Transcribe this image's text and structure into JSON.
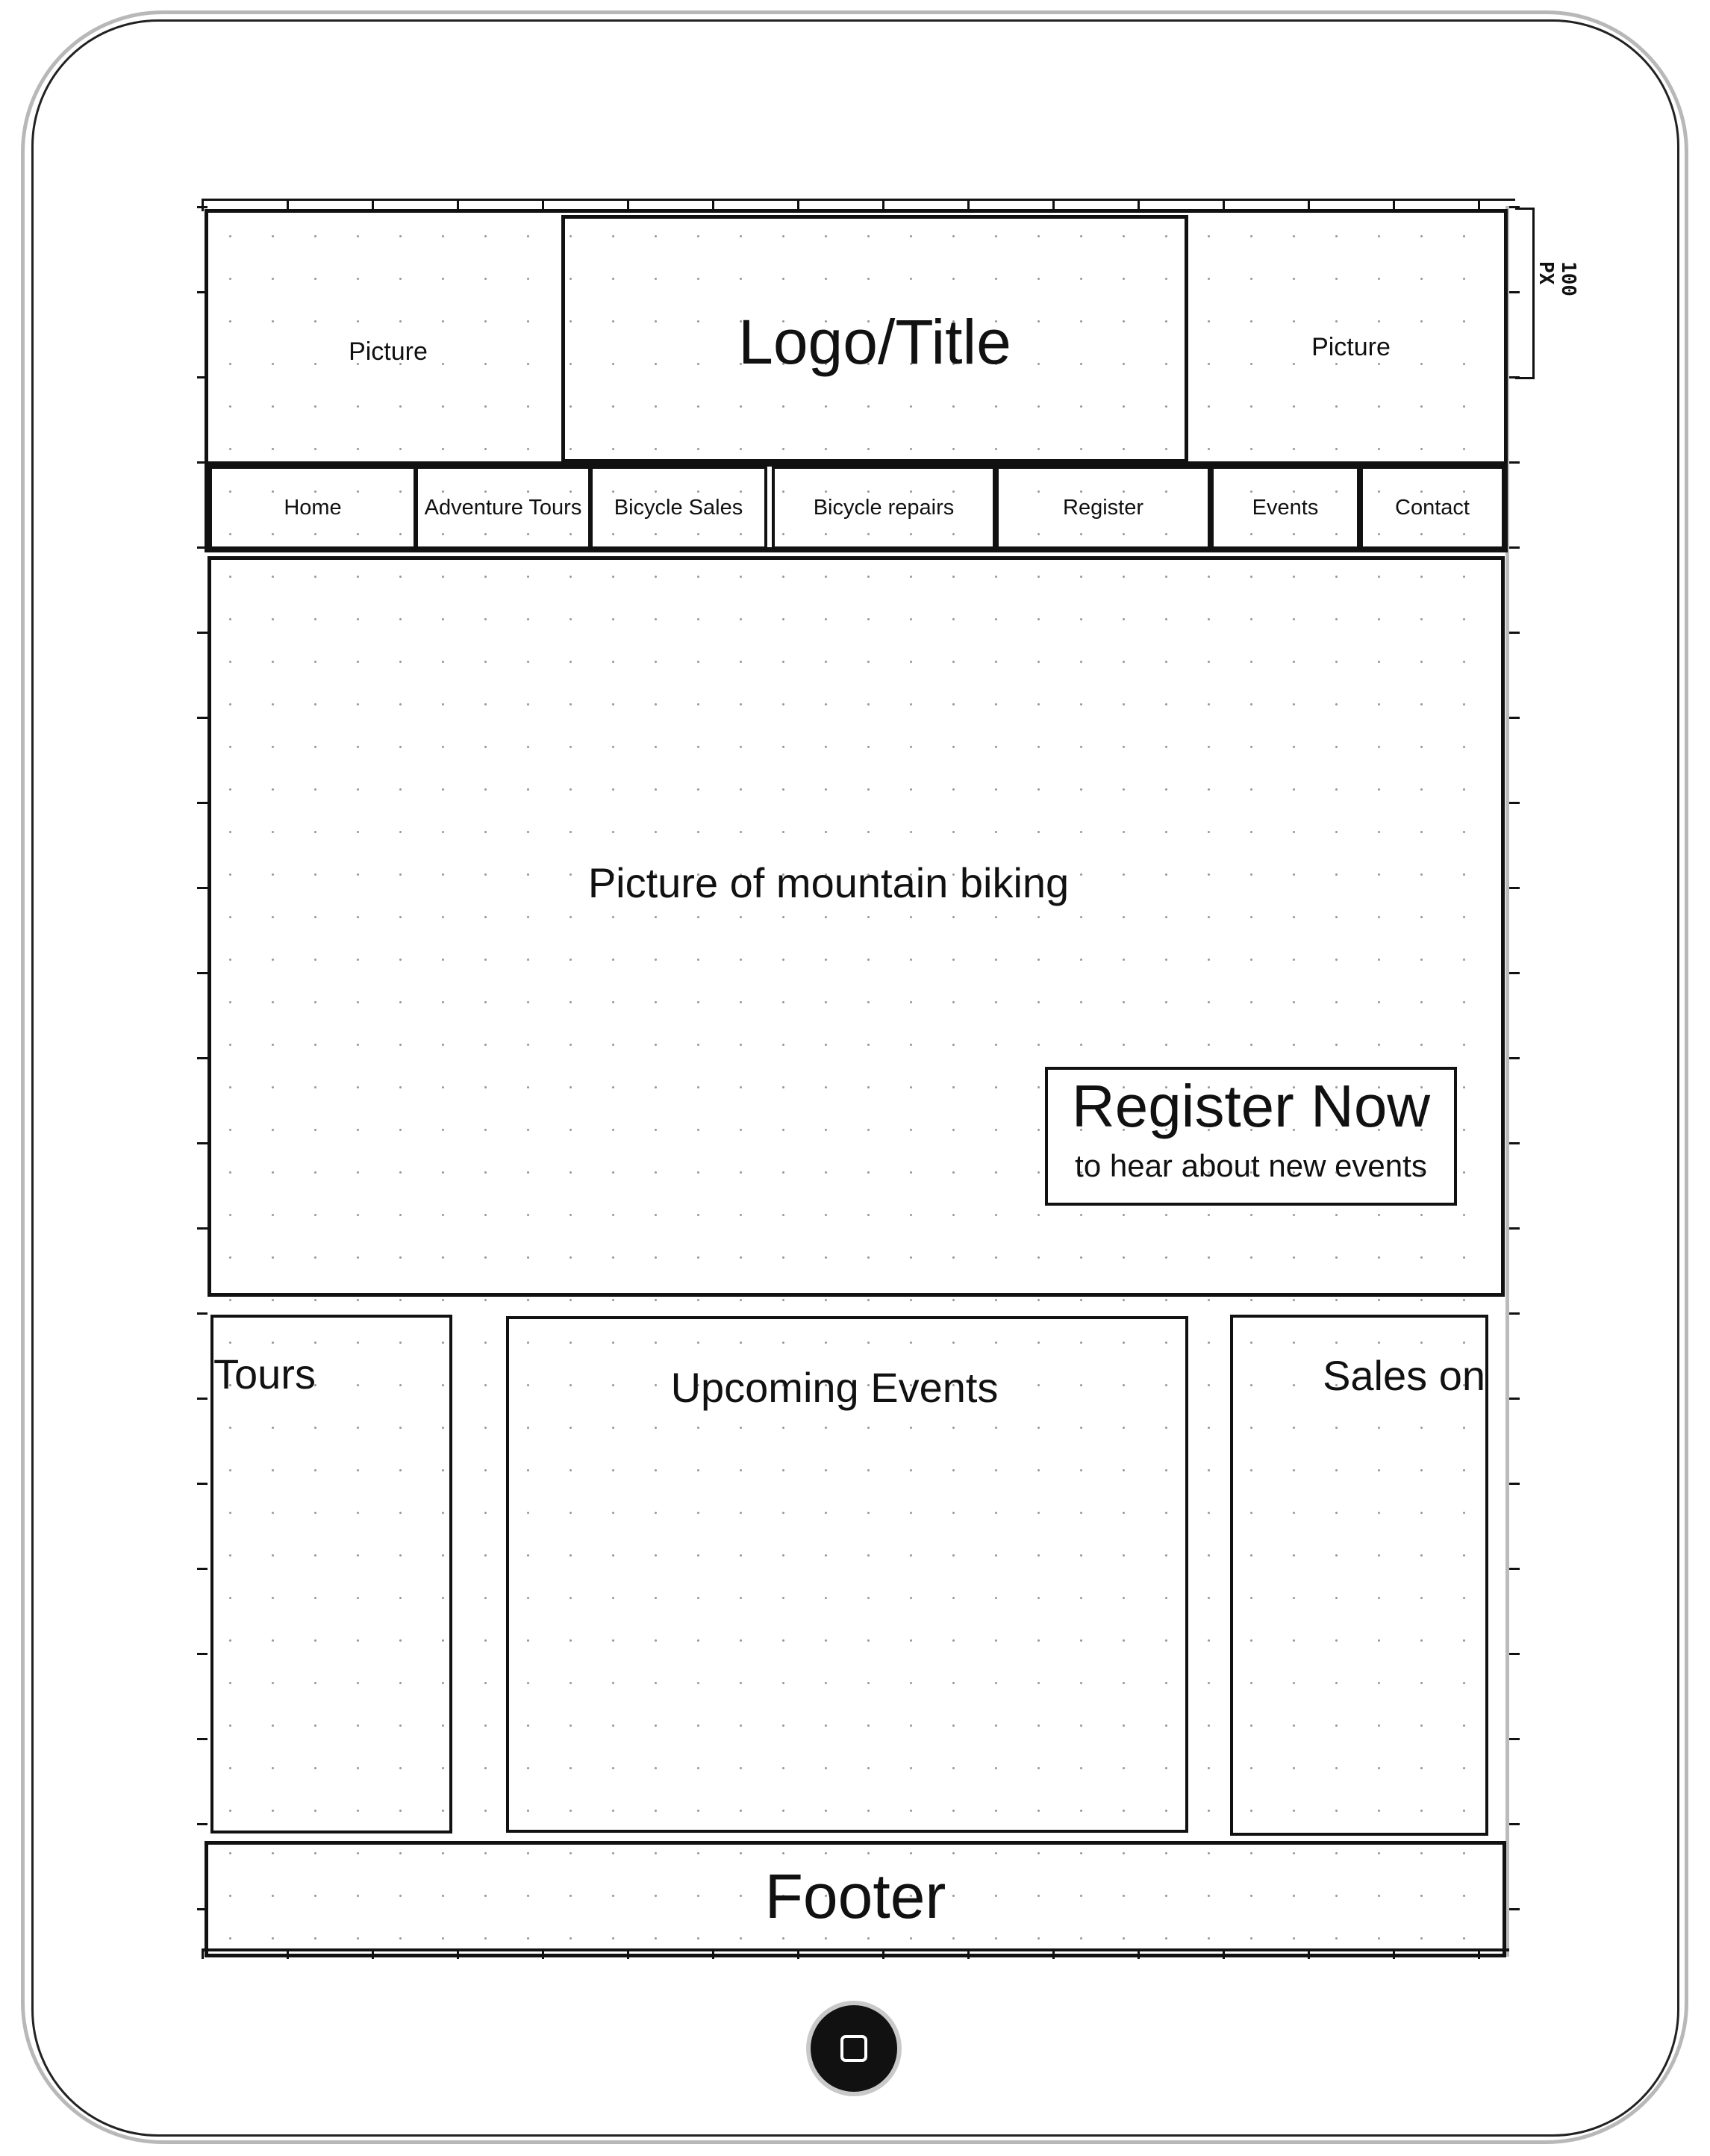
{
  "header": {
    "left_picture": "Picture",
    "logo_title": "Logo/Title",
    "right_picture": "Picture",
    "dimension_label": "100 PX"
  },
  "nav": {
    "items": [
      {
        "label": "Home"
      },
      {
        "label": "Adventure Tours"
      },
      {
        "label": "Bicycle Sales"
      },
      {
        "label": "Bicycle repairs"
      },
      {
        "label": "Register"
      },
      {
        "label": "Events"
      },
      {
        "label": "Contact"
      }
    ]
  },
  "hero": {
    "caption": "Picture of mountain biking",
    "cta_title": "Register Now",
    "cta_subtitle": "to hear about new events"
  },
  "columns": {
    "tours": "Tours",
    "events": "Upcoming Events",
    "sales": "Sales on"
  },
  "footer": {
    "label": "Footer"
  },
  "device": {
    "home_button": "home-button"
  }
}
